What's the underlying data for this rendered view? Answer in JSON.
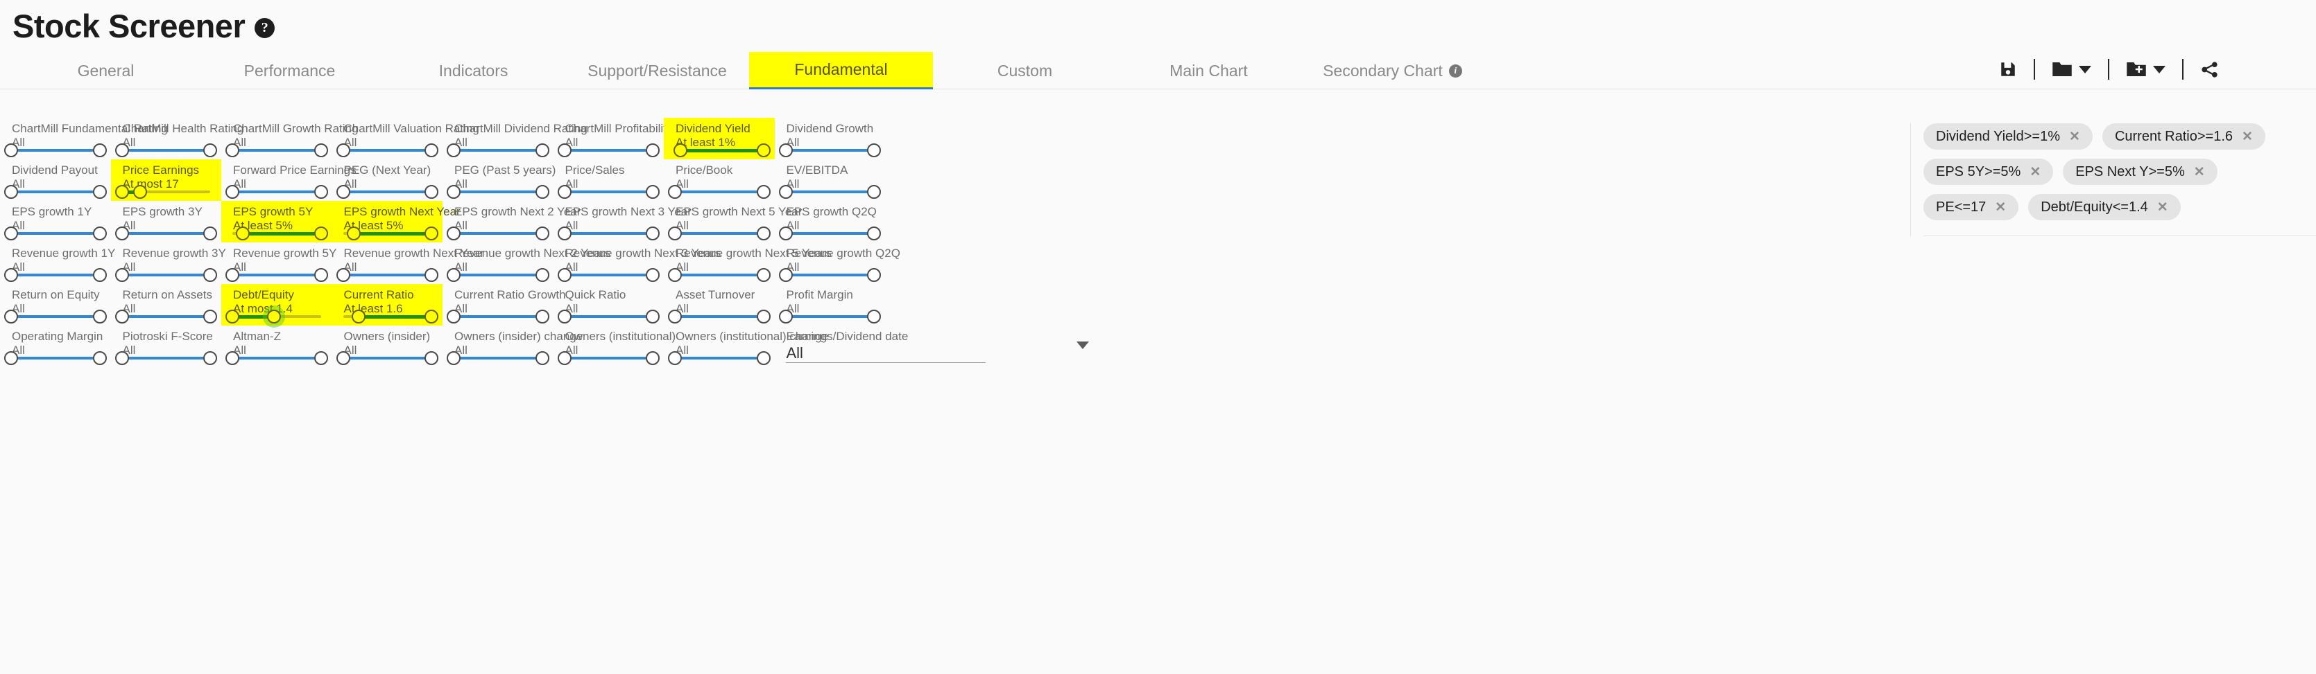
{
  "header": {
    "title": "Stock Screener",
    "help_icon": "question-mark-icon"
  },
  "tabs": [
    {
      "label": "General",
      "active": false
    },
    {
      "label": "Performance",
      "active": false
    },
    {
      "label": "Indicators",
      "active": false
    },
    {
      "label": "Support/Resistance",
      "active": false
    },
    {
      "label": "Fundamental",
      "active": true
    },
    {
      "label": "Custom",
      "active": false
    },
    {
      "label": "Main Chart",
      "active": false
    },
    {
      "label": "Secondary Chart",
      "active": false,
      "info": true
    }
  ],
  "toolbar": {
    "save": "save-icon",
    "open": "folder-icon",
    "open_caret": "chevron-down-icon",
    "new": "folder-plus-icon",
    "new_caret": "chevron-down-icon",
    "share": "share-icon"
  },
  "colors": {
    "highlight": "#ffff00",
    "track": "#2f89d8",
    "active_fill": "#1e9116",
    "tag_bg": "#e4e4e4"
  },
  "filters": [
    [
      {
        "label": "ChartMill Fundamental Rating",
        "value": "All",
        "hl": false,
        "lo": 0,
        "hi": 100
      },
      {
        "label": "ChartMill Health Rating",
        "value": "All",
        "hl": false,
        "lo": 0,
        "hi": 100
      },
      {
        "label": "ChartMill Growth Rating",
        "value": "All",
        "hl": false,
        "lo": 0,
        "hi": 100
      },
      {
        "label": "ChartMill Valuation Rating",
        "value": "All",
        "hl": false,
        "lo": 0,
        "hi": 100
      },
      {
        "label": "ChartMill Dividend Rating",
        "value": "All",
        "hl": false,
        "lo": 0,
        "hi": 100
      },
      {
        "label": "ChartMill Profitability Rating",
        "value": "All",
        "hl": false,
        "lo": 0,
        "hi": 100
      },
      {
        "label": "Dividend Yield",
        "value": "At least 1%",
        "hl": true,
        "lo": 6,
        "hi": 100
      },
      {
        "label": "Dividend Growth",
        "value": "All",
        "hl": false,
        "lo": 0,
        "hi": 100
      }
    ],
    [
      {
        "label": "Dividend Payout",
        "value": "All",
        "hl": false,
        "lo": 0,
        "hi": 100
      },
      {
        "label": "Price Earnings",
        "value": "At most 17",
        "hl": true,
        "lo": 0,
        "hi": 21
      },
      {
        "label": "Forward Price Earnings",
        "value": "All",
        "hl": false,
        "lo": 0,
        "hi": 100
      },
      {
        "label": "PEG (Next Year)",
        "value": "All",
        "hl": false,
        "lo": 0,
        "hi": 100
      },
      {
        "label": "PEG (Past 5 years)",
        "value": "All",
        "hl": false,
        "lo": 0,
        "hi": 100
      },
      {
        "label": "Price/Sales",
        "value": "All",
        "hl": false,
        "lo": 0,
        "hi": 100
      },
      {
        "label": "Price/Book",
        "value": "All",
        "hl": false,
        "lo": 0,
        "hi": 100
      },
      {
        "label": "EV/EBITDA",
        "value": "All",
        "hl": false,
        "lo": 0,
        "hi": 100
      }
    ],
    [
      {
        "label": "EPS growth 1Y",
        "value": "All",
        "hl": false,
        "lo": 0,
        "hi": 100
      },
      {
        "label": "EPS growth 3Y",
        "value": "All",
        "hl": false,
        "lo": 0,
        "hi": 100
      },
      {
        "label": "EPS growth 5Y",
        "value": "At least 5%",
        "hl": true,
        "lo": 12,
        "hi": 100
      },
      {
        "label": "EPS growth Next Year",
        "value": "At least 5%",
        "hl": true,
        "lo": 12,
        "hi": 100
      },
      {
        "label": "EPS growth Next 2 Year",
        "value": "All",
        "hl": false,
        "lo": 0,
        "hi": 100
      },
      {
        "label": "EPS growth Next 3 Year",
        "value": "All",
        "hl": false,
        "lo": 0,
        "hi": 100
      },
      {
        "label": "EPS growth Next 5 Year",
        "value": "All",
        "hl": false,
        "lo": 0,
        "hi": 100
      },
      {
        "label": "EPS growth Q2Q",
        "value": "All",
        "hl": false,
        "lo": 0,
        "hi": 100
      }
    ],
    [
      {
        "label": "Revenue growth 1Y",
        "value": "All",
        "hl": false,
        "lo": 0,
        "hi": 100
      },
      {
        "label": "Revenue growth 3Y",
        "value": "All",
        "hl": false,
        "lo": 0,
        "hi": 100
      },
      {
        "label": "Revenue growth 5Y",
        "value": "All",
        "hl": false,
        "lo": 0,
        "hi": 100
      },
      {
        "label": "Revenue growth Next Year",
        "value": "All",
        "hl": false,
        "lo": 0,
        "hi": 100
      },
      {
        "label": "Revenue growth Next 2 Years",
        "value": "All",
        "hl": false,
        "lo": 0,
        "hi": 100
      },
      {
        "label": "Revenue growth Next 3 Years",
        "value": "All",
        "hl": false,
        "lo": 0,
        "hi": 100
      },
      {
        "label": "Revenue growth Next 5 Years",
        "value": "All",
        "hl": false,
        "lo": 0,
        "hi": 100
      },
      {
        "label": "Revenue growth Q2Q",
        "value": "All",
        "hl": false,
        "lo": 0,
        "hi": 100
      }
    ],
    [
      {
        "label": "Return on Equity",
        "value": "All",
        "hl": false,
        "lo": 0,
        "hi": 100
      },
      {
        "label": "Return on Assets",
        "value": "All",
        "hl": false,
        "lo": 0,
        "hi": 100
      },
      {
        "label": "Debt/Equity",
        "value": "At most 1.4",
        "hl": true,
        "lo": 0,
        "hi": 47,
        "focus_hi": true
      },
      {
        "label": "Current Ratio",
        "value": "At least 1.6",
        "hl": true,
        "lo": 18,
        "hi": 100
      },
      {
        "label": "Current Ratio Growth",
        "value": "All",
        "hl": false,
        "lo": 0,
        "hi": 100
      },
      {
        "label": "Quick Ratio",
        "value": "All",
        "hl": false,
        "lo": 0,
        "hi": 100
      },
      {
        "label": "Asset Turnover",
        "value": "All",
        "hl": false,
        "lo": 0,
        "hi": 100
      },
      {
        "label": "Profit Margin",
        "value": "All",
        "hl": false,
        "lo": 0,
        "hi": 100
      }
    ],
    [
      {
        "label": "Operating Margin",
        "value": "All",
        "hl": false,
        "lo": 0,
        "hi": 100
      },
      {
        "label": "Piotroski F-Score",
        "value": "All",
        "hl": false,
        "lo": 0,
        "hi": 100
      },
      {
        "label": "Altman-Z",
        "value": "All",
        "hl": false,
        "lo": 0,
        "hi": 100
      },
      {
        "label": "Owners (insider)",
        "value": "All",
        "hl": false,
        "lo": 0,
        "hi": 100
      },
      {
        "label": "Owners (insider) change",
        "value": "All",
        "hl": false,
        "lo": 0,
        "hi": 100
      },
      {
        "label": "Owners (institutional)",
        "value": "All",
        "hl": false,
        "lo": 0,
        "hi": 100
      },
      {
        "label": "Owners (institutional) change",
        "value": "All",
        "hl": false,
        "lo": 0,
        "hi": 100
      },
      {
        "label": "Earnings/Dividend date",
        "value": "All",
        "hl": false,
        "select": true
      }
    ]
  ],
  "active_filter_tags": [
    {
      "label": "Dividend Yield>=1%"
    },
    {
      "label": "Current Ratio>=1.6"
    },
    {
      "label": "EPS 5Y>=5%"
    },
    {
      "label": "EPS Next Y>=5%"
    },
    {
      "label": "PE<=17"
    },
    {
      "label": "Debt/Equity<=1.4"
    }
  ]
}
